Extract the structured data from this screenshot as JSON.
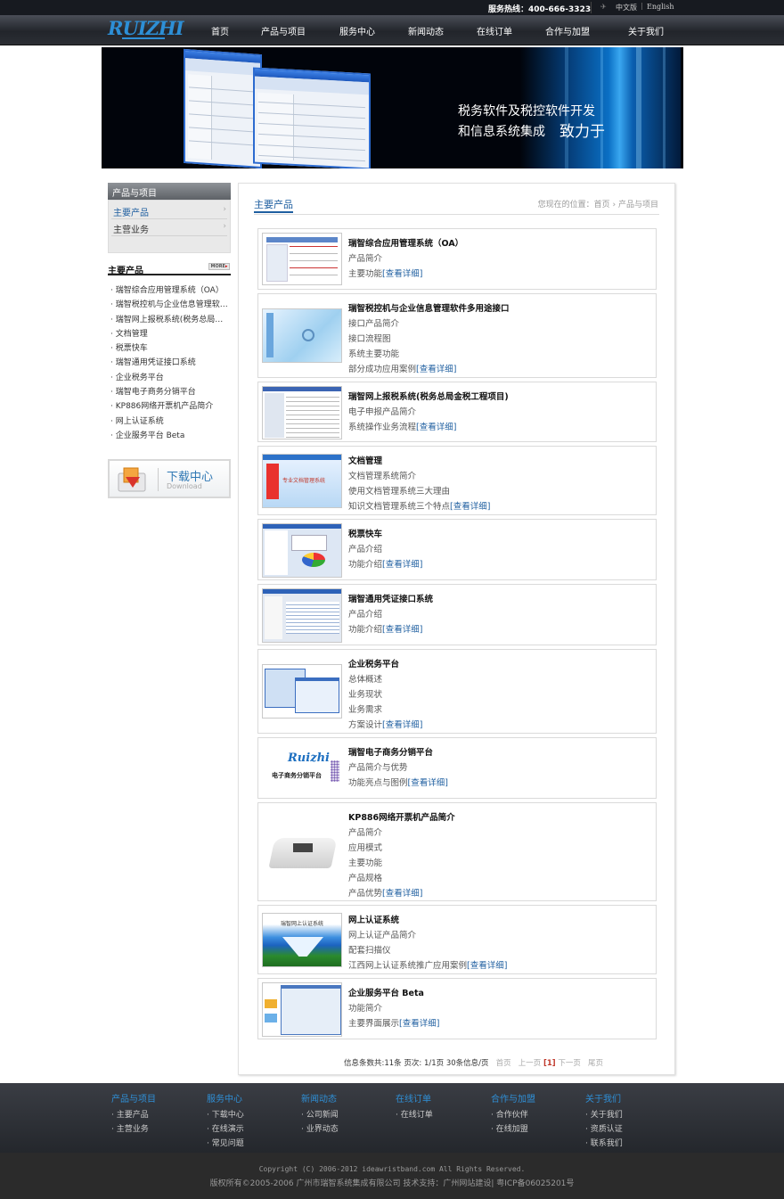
{
  "topbar": {
    "hotline": "服务热线：400-666-3323",
    "lang_cn": "中文版",
    "lang_sep": "|",
    "lang_en": "English"
  },
  "logo": {
    "text": "RUIZHI"
  },
  "nav": [
    "首页",
    "产品与项目",
    "服务中心",
    "新闻动态",
    "在线订单",
    "合作与加盟",
    "关于我们"
  ],
  "banner": {
    "line1": "致力于",
    "line2": "税务软件及税控软件开发",
    "line3": "和信息系统集成"
  },
  "sidebar": {
    "title": "产品与项目",
    "menu": [
      {
        "label": "主要产品",
        "arrow": "›"
      },
      {
        "label": "主营业务",
        "arrow": "›"
      }
    ],
    "products_title": "主要产品",
    "more_label": "MORE",
    "more_arrow": "▸",
    "products": [
      "瑞智综合应用管理系统（OA）",
      "瑞智税控机与企业信息管理软件多用途接口",
      "瑞智网上报税系统(税务总局金税工程项目)",
      "文档管理",
      "税票快车",
      "瑞智通用凭证接口系统",
      "企业税务平台",
      "瑞智电子商务分销平台",
      "KP886网络开票机产品简介",
      "网上认证系统",
      "企业服务平台 Beta"
    ],
    "download_title": "下载中心",
    "download_sub": "Download"
  },
  "main": {
    "title": "主要产品",
    "breadcrumb": "您现在的位置：首页 › 产品与项目",
    "detail_label": "[查看详细]",
    "cards": [
      {
        "title": "瑞智综合应用管理系统（OA）",
        "lines": [
          "产品简介",
          "主要功能"
        ]
      },
      {
        "title": "瑞智税控机与企业信息管理软件多用途接口",
        "lines": [
          "接口产品简介",
          "接口流程图",
          "系统主要功能",
          "部分成功应用案例"
        ]
      },
      {
        "title": "瑞智网上报税系统(税务总局金税工程项目)",
        "lines": [
          "电子申报产品简介",
          "系统操作业务流程"
        ]
      },
      {
        "title": "文档管理",
        "lines": [
          "文档管理系统简介",
          "使用文档管理系统三大理由",
          "知识文档管理系统三个特点"
        ]
      },
      {
        "title": "税票快车",
        "lines": [
          "产品介绍",
          "功能介绍"
        ]
      },
      {
        "title": "瑞智通用凭证接口系统",
        "lines": [
          "产品介绍",
          "功能介绍"
        ]
      },
      {
        "title": "企业税务平台",
        "lines": [
          "总体概述",
          "业务现状",
          "业务需求",
          "方案设计"
        ]
      },
      {
        "title": "瑞智电子商务分销平台",
        "lines": [
          "产品简介与优势",
          "功能亮点与图例"
        ]
      },
      {
        "title": "KP886网络开票机产品简介",
        "lines": [
          "产品简介",
          "应用模式",
          "主要功能",
          "产品规格",
          "产品优势"
        ]
      },
      {
        "title": "网上认证系统",
        "lines": [
          "网上认证产品简介",
          "配套扫描仪",
          "江西网上认证系统推广应用案例"
        ]
      },
      {
        "title": "企业服务平台 Beta",
        "lines": [
          "功能简介",
          "主要界面展示"
        ]
      }
    ],
    "thumb_labels": {
      "doc": "专业文档管理系统",
      "ruizhi": "Ruizhi",
      "ecom": "电子商务分销平台",
      "auth": "瑞智网上认证系统"
    },
    "pager": {
      "info": "信息条数共:11条  页次: 1/1页   30条信息/页",
      "first": "首页",
      "prev": "上一页",
      "current": "[1]",
      "next": "下一页",
      "last": "尾页"
    }
  },
  "footer": {
    "columns": [
      {
        "head": "产品与项目",
        "links": [
          "主要产品",
          "主营业务"
        ]
      },
      {
        "head": "服务中心",
        "links": [
          "下载中心",
          "在线演示",
          "常见问题"
        ]
      },
      {
        "head": "新闻动态",
        "links": [
          "公司新闻",
          "业界动态"
        ]
      },
      {
        "head": "在线订单",
        "links": [
          "在线订单"
        ]
      },
      {
        "head": "合作与加盟",
        "links": [
          "合作伙伴",
          "在线加盟"
        ]
      },
      {
        "head": "关于我们",
        "links": [
          "关于我们",
          "资质认证",
          "联系我们"
        ]
      }
    ],
    "copyright": "Copyright (C) 2006-2012 ideawristband.com All Rights Reserved.",
    "icp": "版权所有©2005-2006 广州市瑞智系统集成有限公司  技术支持：广州网站建设|   粤ICP备06025201号"
  },
  "colors": {
    "accent": "#1f5fa0",
    "logo": "#2d8fd6",
    "dark": "#22252b"
  }
}
